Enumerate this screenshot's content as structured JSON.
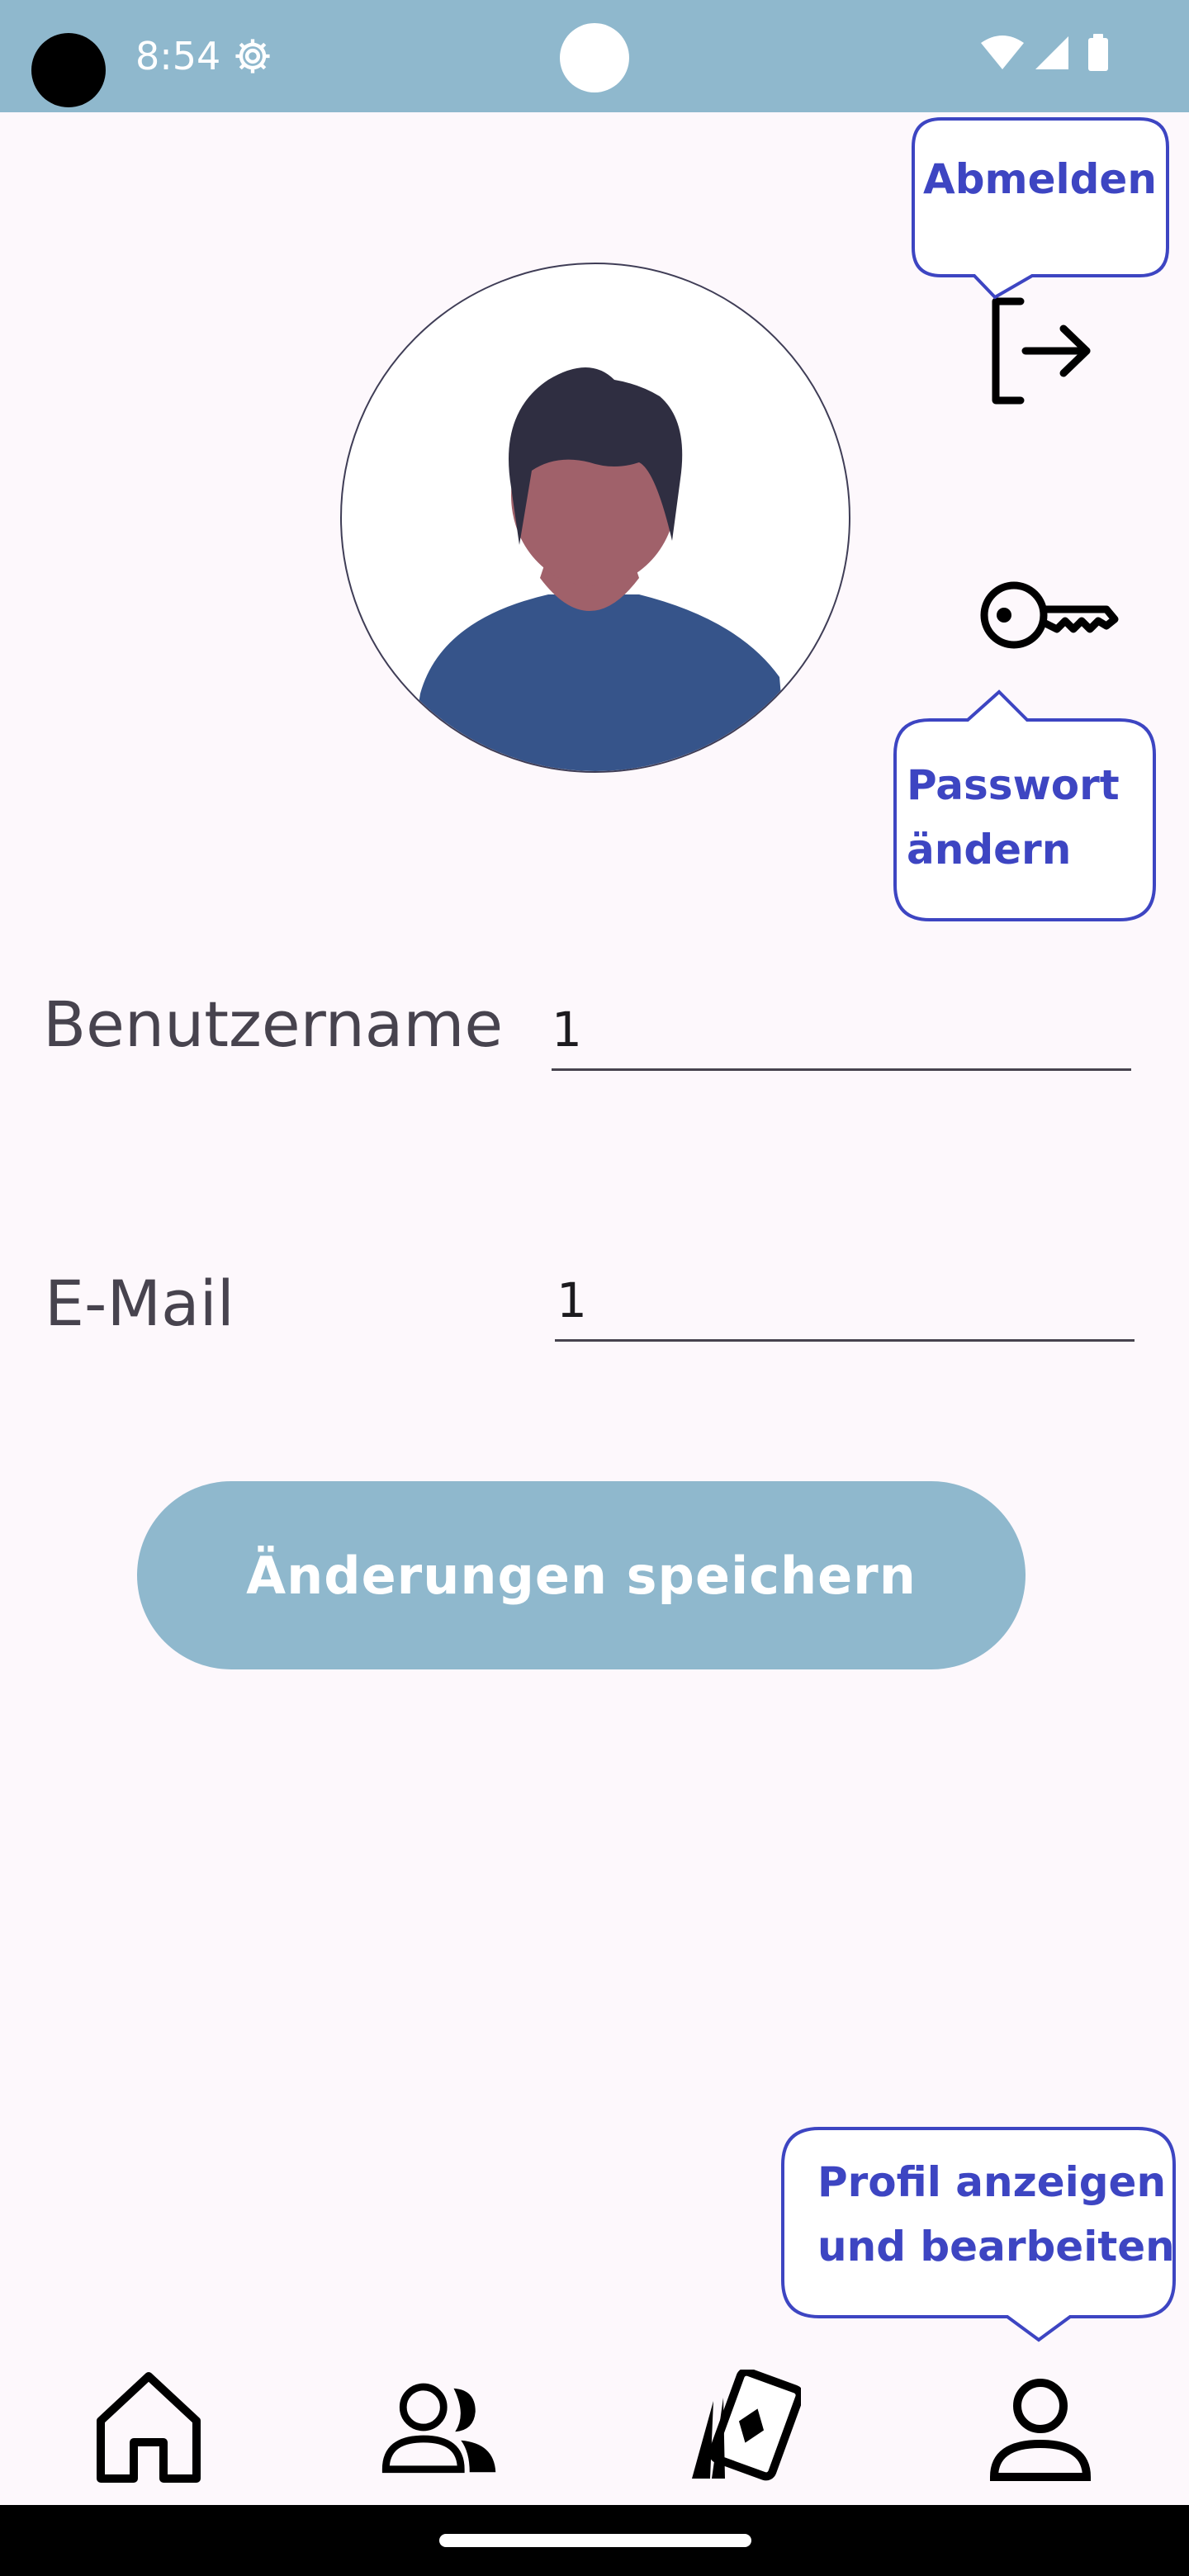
{
  "status_bar": {
    "time": "8:54",
    "icons": [
      "settings-icon",
      "wifi-icon",
      "signal-icon",
      "battery-icon"
    ]
  },
  "header_actions": {
    "logout_icon": "logout-icon",
    "change_password_icon": "key-icon"
  },
  "callouts": {
    "logout": "Abmelden",
    "change_password_line1": "Passwort",
    "change_password_line2": "ändern",
    "profile_line1": "Profil anzeigen",
    "profile_line2": "und bearbeiten"
  },
  "form": {
    "username_label": "Benutzername",
    "username_value": "1",
    "email_label": "E-Mail",
    "email_value": "1",
    "save_label": "Änderungen speichern"
  },
  "bottom_nav": {
    "items": [
      {
        "icon": "home-icon"
      },
      {
        "icon": "people-icon"
      },
      {
        "icon": "cards-icon"
      },
      {
        "icon": "person-icon"
      }
    ]
  },
  "colors": {
    "accent": "#8fb8cd",
    "callout": "#3d45c2",
    "background": "#fdf8fc",
    "text": "#47434e"
  }
}
